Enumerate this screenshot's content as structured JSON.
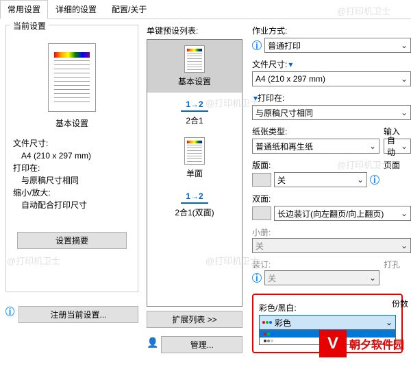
{
  "tabs": [
    "常用设置",
    "详细的设置",
    "配置/关于"
  ],
  "left": {
    "current_title": "当前设置",
    "preview_label": "基本设置",
    "info_lines": {
      "l1": "文件尺寸:",
      "l2": "　A4 (210 x 297 mm)",
      "l3": "打印在:",
      "l4": "　与原稿尺寸相同",
      "l5": "缩小/放大:",
      "l6": "　自动配合打印尺寸"
    },
    "summary_btn": "设置摘要",
    "register_btn": "注册当前设置..."
  },
  "center": {
    "list_label": "单键预设列表:",
    "items": [
      "基本设置",
      "2合1",
      "单面",
      "2合1(双面)"
    ],
    "expand_btn": "扩展列表 >>",
    "manage_btn": "管理..."
  },
  "right": {
    "job_label": "作业方式:",
    "job_value": "普通打印",
    "doc_size_label": "文件尺寸:",
    "doc_size_value": "A4 (210 x 297 mm)",
    "print_on_label": "打印在:",
    "print_on_value": "与原稿尺寸相同",
    "paper_type_label": "纸张类型:",
    "paper_type_value": "普通纸和再生纸",
    "input_label": "输入",
    "input_value": "自动",
    "layout_label": "版面:",
    "layout_value": "关",
    "page_label": "页面",
    "duplex_label": "双面:",
    "duplex_value": "长边装订(向左翻页/向上翻页)",
    "booklet_label": "小册:",
    "booklet_value": "关",
    "staple_label": "装订:",
    "staple_value": "关",
    "punch_label": "打孔",
    "color_label": "彩色/黑白:",
    "color_value": "彩色",
    "copies_label": "份数"
  },
  "watermarks": [
    "@打印机卫士",
    "@打印机卫士",
    "@打印机卫士",
    "@打印机卫士",
    "@打印机卫士"
  ],
  "logo_text": "朝夕软件园"
}
